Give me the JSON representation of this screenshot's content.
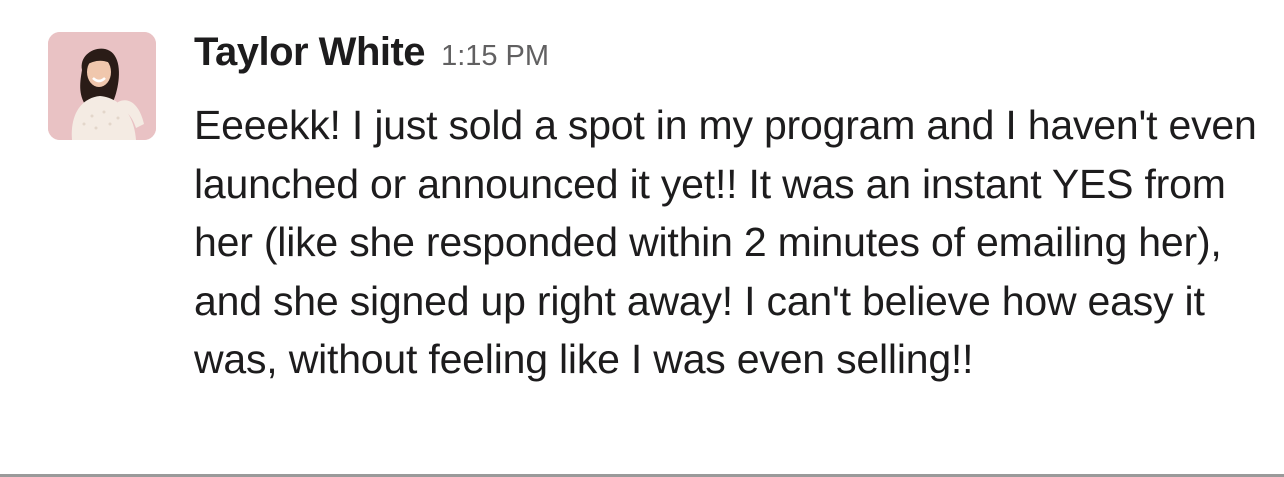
{
  "message": {
    "author": "Taylor White",
    "timestamp": "1:15 PM",
    "text": "Eeeekk! I just sold a spot in my program and I haven't even launched or announced it yet!! It was an instant YES from her (like she responded within 2 minutes of emailing her), and she signed up right away! I can't believe how easy it was, without feeling like I was even selling!!"
  },
  "colors": {
    "avatar_background": "#e9c2c4",
    "text": "#1d1c1d",
    "timestamp": "#616061"
  }
}
